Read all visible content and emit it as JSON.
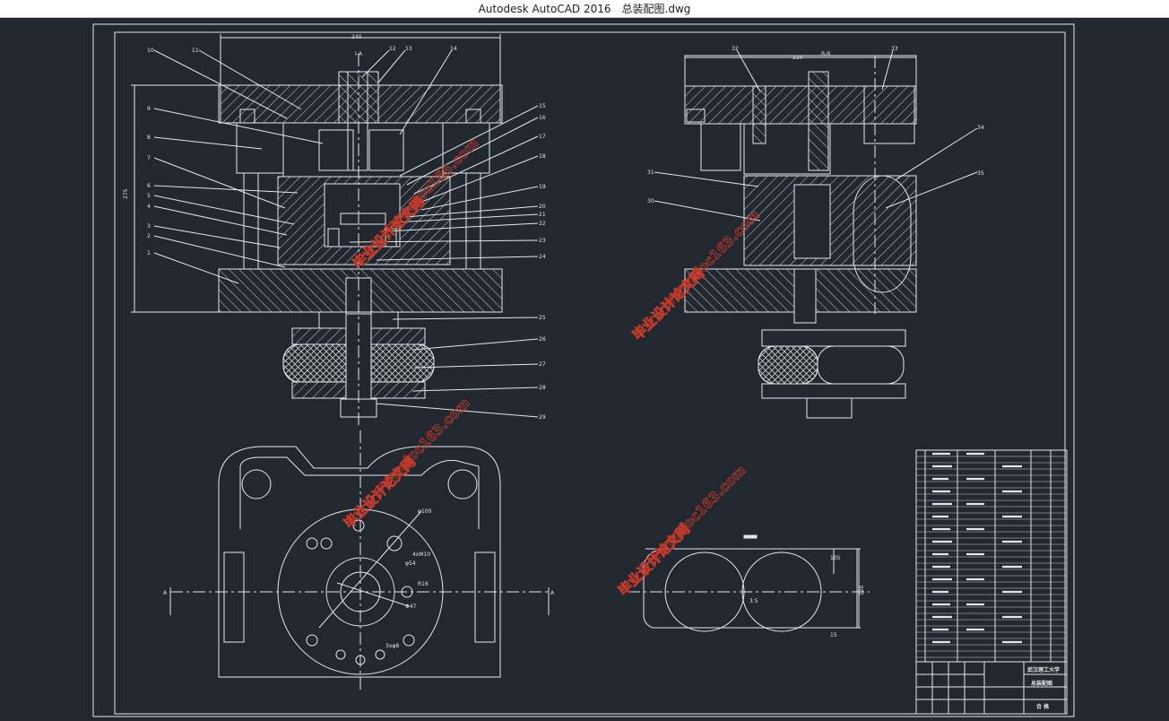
{
  "window": {
    "app_title": "Autodesk AutoCAD 2016",
    "file_name": "总装配图.dwg"
  },
  "drawing": {
    "section_left_label": "I-A",
    "section_right_label": "B-B",
    "dim_width_left": "240",
    "dim_width_right": "220",
    "dim_height_left": "275",
    "title_block": {
      "school": "武汉理工大学",
      "drawing_name": "总装配图",
      "assembly": "合 格"
    },
    "part_numbers_left": [
      "10",
      "11",
      "9",
      "8",
      "7",
      "6",
      "5",
      "4",
      "3",
      "2",
      "1"
    ],
    "part_numbers_top": [
      "12",
      "13",
      "14"
    ],
    "part_numbers_right": [
      "15",
      "16",
      "17",
      "18",
      "19",
      "20",
      "21",
      "22",
      "23",
      "24",
      "25",
      "26",
      "27",
      "28",
      "29"
    ],
    "part_numbers_side": [
      "32",
      "33",
      "31",
      "30",
      "34",
      "35"
    ],
    "plan_dims": [
      "φ100",
      "φ54",
      "R16",
      "Φ47",
      "4xM10",
      "3xφ8"
    ],
    "strip_dims": [
      "120",
      "105",
      "15",
      "3.5"
    ]
  },
  "watermarks": [
    "毕业设计论文网",
    "www.doc163.com"
  ],
  "colors": {
    "background": "#212830",
    "line": "#e6e6e6",
    "watermark": "#c03a2b"
  }
}
